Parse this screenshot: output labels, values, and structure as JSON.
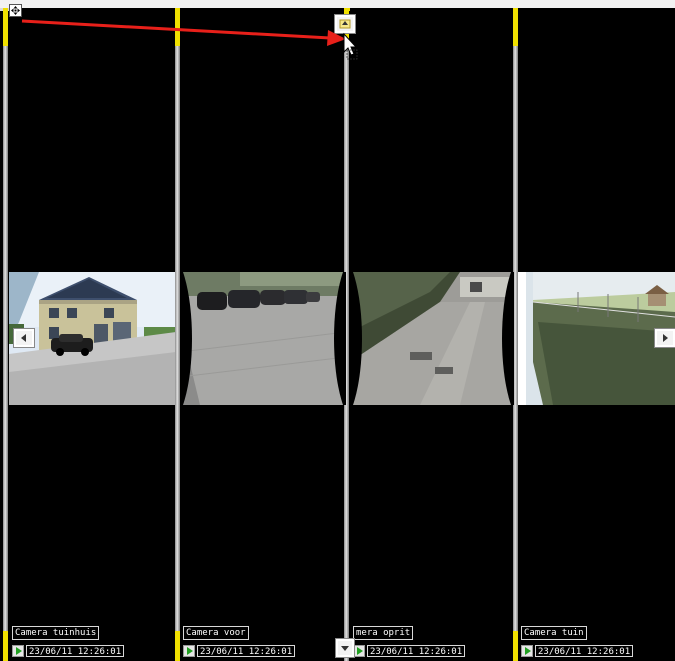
{
  "cameras": [
    {
      "label": "Camera tuinhuis",
      "time": "23/06/11 12:26:01"
    },
    {
      "label": "Camera voor",
      "time": "23/06/11 12:26:01"
    },
    {
      "label": "mera oprit",
      "time": "23/06/11 12:26:01"
    },
    {
      "label": "Camera tuin",
      "time": "23/06/11 12:26:01"
    }
  ],
  "icons": {
    "move": "move-icon",
    "scroll_up": "arrow-up-icon",
    "scroll_down": "arrow-down-icon",
    "scroll_left": "arrow-left-icon",
    "scroll_right": "arrow-right-icon",
    "cursor": "mouse-pointer-icon",
    "play": "play-icon"
  },
  "colors": {
    "divider_marker": "#f0e000",
    "drag_arrow": "#e8201a",
    "timestamp_play": "#21a021",
    "background": "#000000"
  }
}
